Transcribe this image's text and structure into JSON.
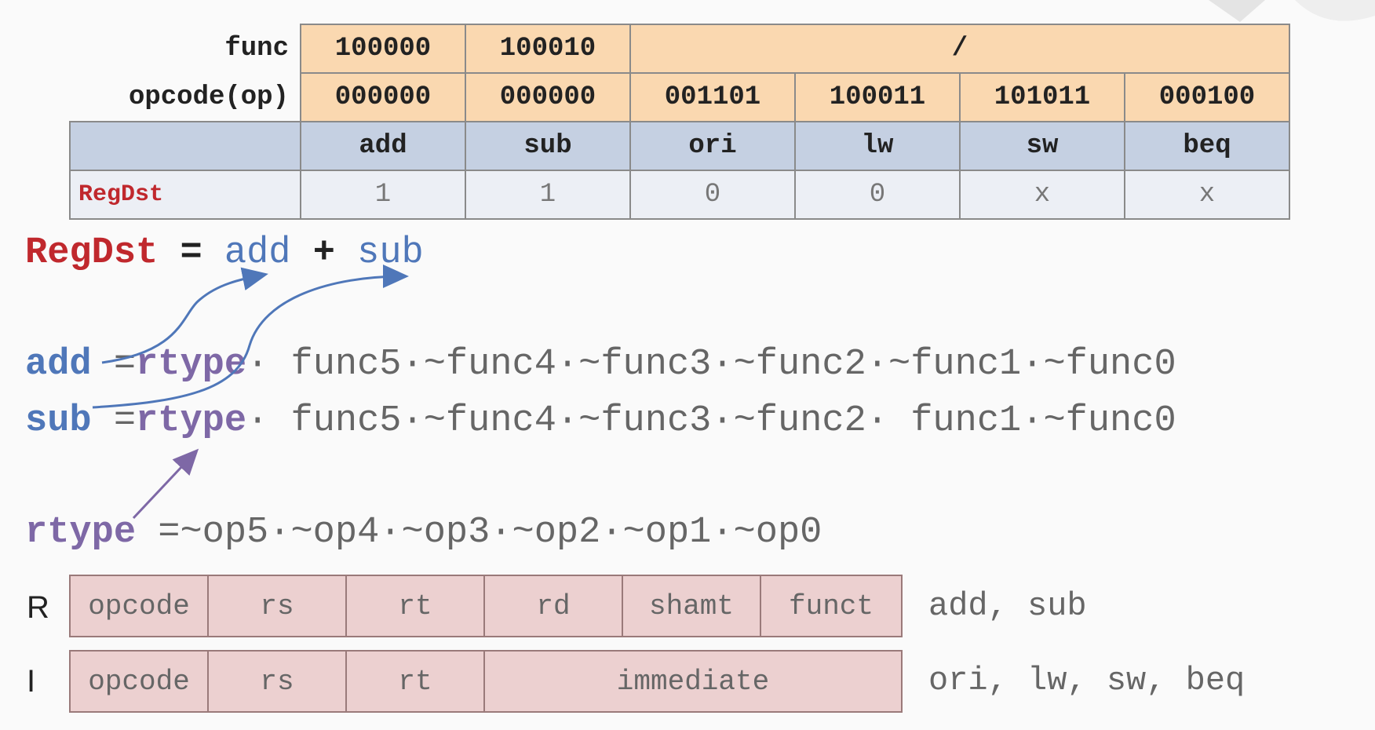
{
  "table": {
    "func_label": "func",
    "opcode_label": "opcode(op)",
    "func_values": [
      "100000",
      "100010",
      "/"
    ],
    "opcode_values": [
      "000000",
      "000000",
      "001101",
      "100011",
      "101011",
      "000100"
    ],
    "instructions": [
      "add",
      "sub",
      "ori",
      "lw",
      "sw",
      "beq"
    ],
    "signal_label": "RegDst",
    "signal_values": [
      "1",
      "1",
      "0",
      "0",
      "x",
      "x"
    ]
  },
  "equations": {
    "regdst": {
      "lhs": "RegDst",
      "eq": " = ",
      "t1": "add",
      "plus": " + ",
      "t2": "sub"
    },
    "add": {
      "lhs": "add",
      "eq": " =",
      "rtype": "rtype",
      "rest": "· func5·~func4·~func3·~func2·~func1·~func0"
    },
    "sub": {
      "lhs": "sub",
      "eq": " =",
      "rtype": "rtype",
      "rest": "· func5·~func4·~func3·~func2· func1·~func0"
    },
    "rtype": {
      "lhs": "rtype",
      "rest": " =~op5·~op4·~op3·~op2·~op1·~op0"
    }
  },
  "formats": {
    "r": {
      "label": "R",
      "fields": [
        "opcode",
        "rs",
        "rt",
        "rd",
        "shamt",
        "funct"
      ],
      "note": "add, sub"
    },
    "i": {
      "label": "I",
      "fields": [
        "opcode",
        "rs",
        "rt",
        "immediate"
      ],
      "note": "ori, lw, sw, beq"
    }
  },
  "colors": {
    "header_orange": "#fad8b0",
    "header_blue": "#c5d0e2",
    "signal_red": "#c0282d",
    "term_blue": "#4f77b9",
    "rtype_purple": "#7e68a6",
    "format_pink": "#ecd0d0"
  }
}
